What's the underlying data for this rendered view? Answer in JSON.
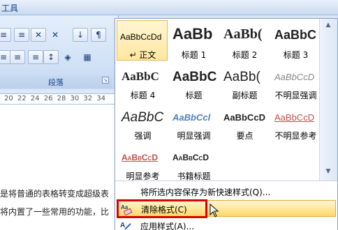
{
  "window": {
    "title_fragment": "工具"
  },
  "ribbon": {
    "group_label": "段落",
    "launcher_glyph": "↘",
    "buttons": [
      "≡",
      "≡",
      "✕",
      "↓",
      "¶",
      "≡",
      "≡",
      "≡",
      "↕",
      "◈",
      "▦"
    ]
  },
  "ruler": {
    "numbers": "20 22 24 26 28 30 32 34"
  },
  "document": {
    "line1": "是将普通的表格转变成超级表",
    "line2": "将内置了一些常用的功能，比"
  },
  "styles_gallery": {
    "rows": [
      [
        {
          "sample": "AaBbCcDd",
          "label": "↵ 正文",
          "selected": true
        },
        {
          "sample": "AaBb",
          "label": "标题 1"
        },
        {
          "sample": "AaBb(",
          "label": "标题 2"
        },
        {
          "sample": "AaBbC",
          "label": "标题 3"
        }
      ],
      [
        {
          "sample": "AaBbC",
          "label": "标题 4"
        },
        {
          "sample": "AaBbC",
          "label": "标题"
        },
        {
          "sample": "AaBb(",
          "label": "副标题"
        },
        {
          "sample": "AaBbCcD",
          "label": "不明显强调"
        }
      ],
      [
        {
          "sample": "AaBbC",
          "label": "强调"
        },
        {
          "sample": "AaBbCcl",
          "label": "明显强调"
        },
        {
          "sample": "AaBbCcD",
          "label": "要点"
        },
        {
          "sample": "AaBbCcD",
          "label": "不明显参考"
        }
      ],
      [
        {
          "sample": "AaBbCcD",
          "label": "明显参考"
        },
        {
          "sample": "AaBbCcD",
          "label": "书籍标题"
        }
      ]
    ]
  },
  "menu": {
    "save_as_quick_style": "将所选内容保存为新快速样式(Q)...",
    "clear_formatting": "清除格式(C)",
    "apply_styles": "应用样式(A)..."
  },
  "colors": {
    "highlight_border": "#e00000",
    "hover_gradient_top": "#fff6cf",
    "hover_gradient_bottom": "#ffd86b",
    "accent": "#15428b"
  }
}
